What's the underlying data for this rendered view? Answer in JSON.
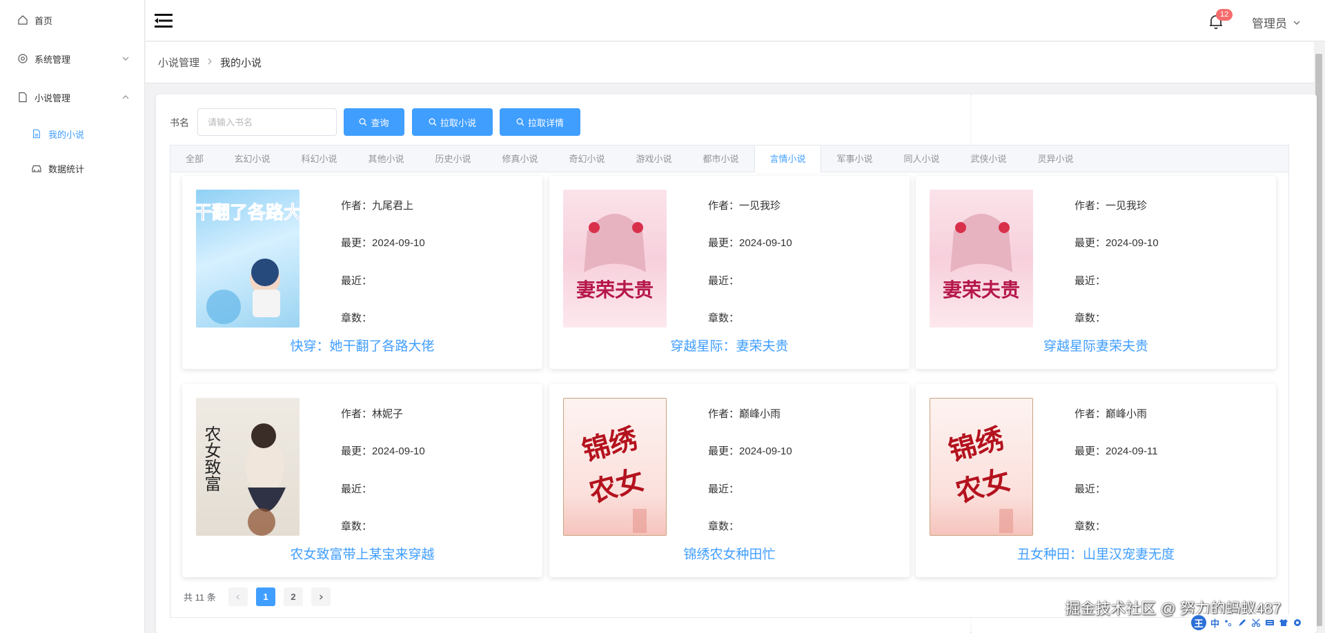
{
  "sidebar": {
    "items": [
      {
        "label": "首页",
        "icon": "home-icon"
      },
      {
        "label": "系统管理",
        "icon": "gear-icon"
      },
      {
        "label": "小说管理",
        "icon": "document-icon"
      },
      {
        "label": "我的小说",
        "icon": "file-icon"
      },
      {
        "label": "数据统计",
        "icon": "car-icon"
      }
    ]
  },
  "header": {
    "notification_count": "12",
    "user_name": "管理员"
  },
  "breadcrumb": {
    "parent": "小说管理",
    "separator": ">",
    "current": "我的小说"
  },
  "search": {
    "label": "书名",
    "placeholder": "请输入书名",
    "query_button": "查询",
    "pull_button": "拉取小说",
    "detail_button": "拉取详情"
  },
  "tabs": [
    "全部",
    "玄幻小说",
    "科幻小说",
    "其他小说",
    "历史小说",
    "修真小说",
    "奇幻小说",
    "游戏小说",
    "都市小说",
    "言情小说",
    "军事小说",
    "同人小说",
    "武侠小说",
    "灵异小说"
  ],
  "active_tab": "言情小说",
  "book_labels": {
    "author": "作者：",
    "updated": "最更：",
    "latest": "最近：",
    "chapters": "章数："
  },
  "books": [
    {
      "title": "快穿：她干翻了各路大佬",
      "author": "九尾君上",
      "updated": "2024-09-10",
      "latest": "",
      "chapters": "",
      "cover_text": "她干翻了各路大佬"
    },
    {
      "title": "穿越星际：妻荣夫贵",
      "author": "一见我珍",
      "updated": "2024-09-10",
      "latest": "",
      "chapters": "",
      "cover_text": "妻荣夫贵"
    },
    {
      "title": "穿越星际妻荣夫贵",
      "author": "一见我珍",
      "updated": "2024-09-10",
      "latest": "",
      "chapters": "",
      "cover_text": "妻荣夫贵"
    },
    {
      "title": "农女致富带上某宝来穿越",
      "author": "林妮子",
      "updated": "2024-09-10",
      "latest": "",
      "chapters": "",
      "cover_text": "农女致富"
    },
    {
      "title": "锦绣农女种田忙",
      "author": "巅峰小雨",
      "updated": "2024-09-10",
      "latest": "",
      "chapters": "",
      "cover_text": "锦绣农女"
    },
    {
      "title": "丑女种田：山里汉宠妻无度",
      "author": "巅峰小雨",
      "updated": "2024-09-11",
      "latest": "",
      "chapters": "",
      "cover_text": "锦绣农女"
    }
  ],
  "pagination": {
    "total": "共 11 条",
    "pages": [
      "1",
      "2"
    ],
    "current": "1"
  },
  "watermark": "掘金技术社区 @ 努力的蚂蚁487",
  "ime": {
    "logo": "王",
    "mode": "中"
  },
  "colors": {
    "primary": "#409eff",
    "badge": "#f56c6c"
  }
}
